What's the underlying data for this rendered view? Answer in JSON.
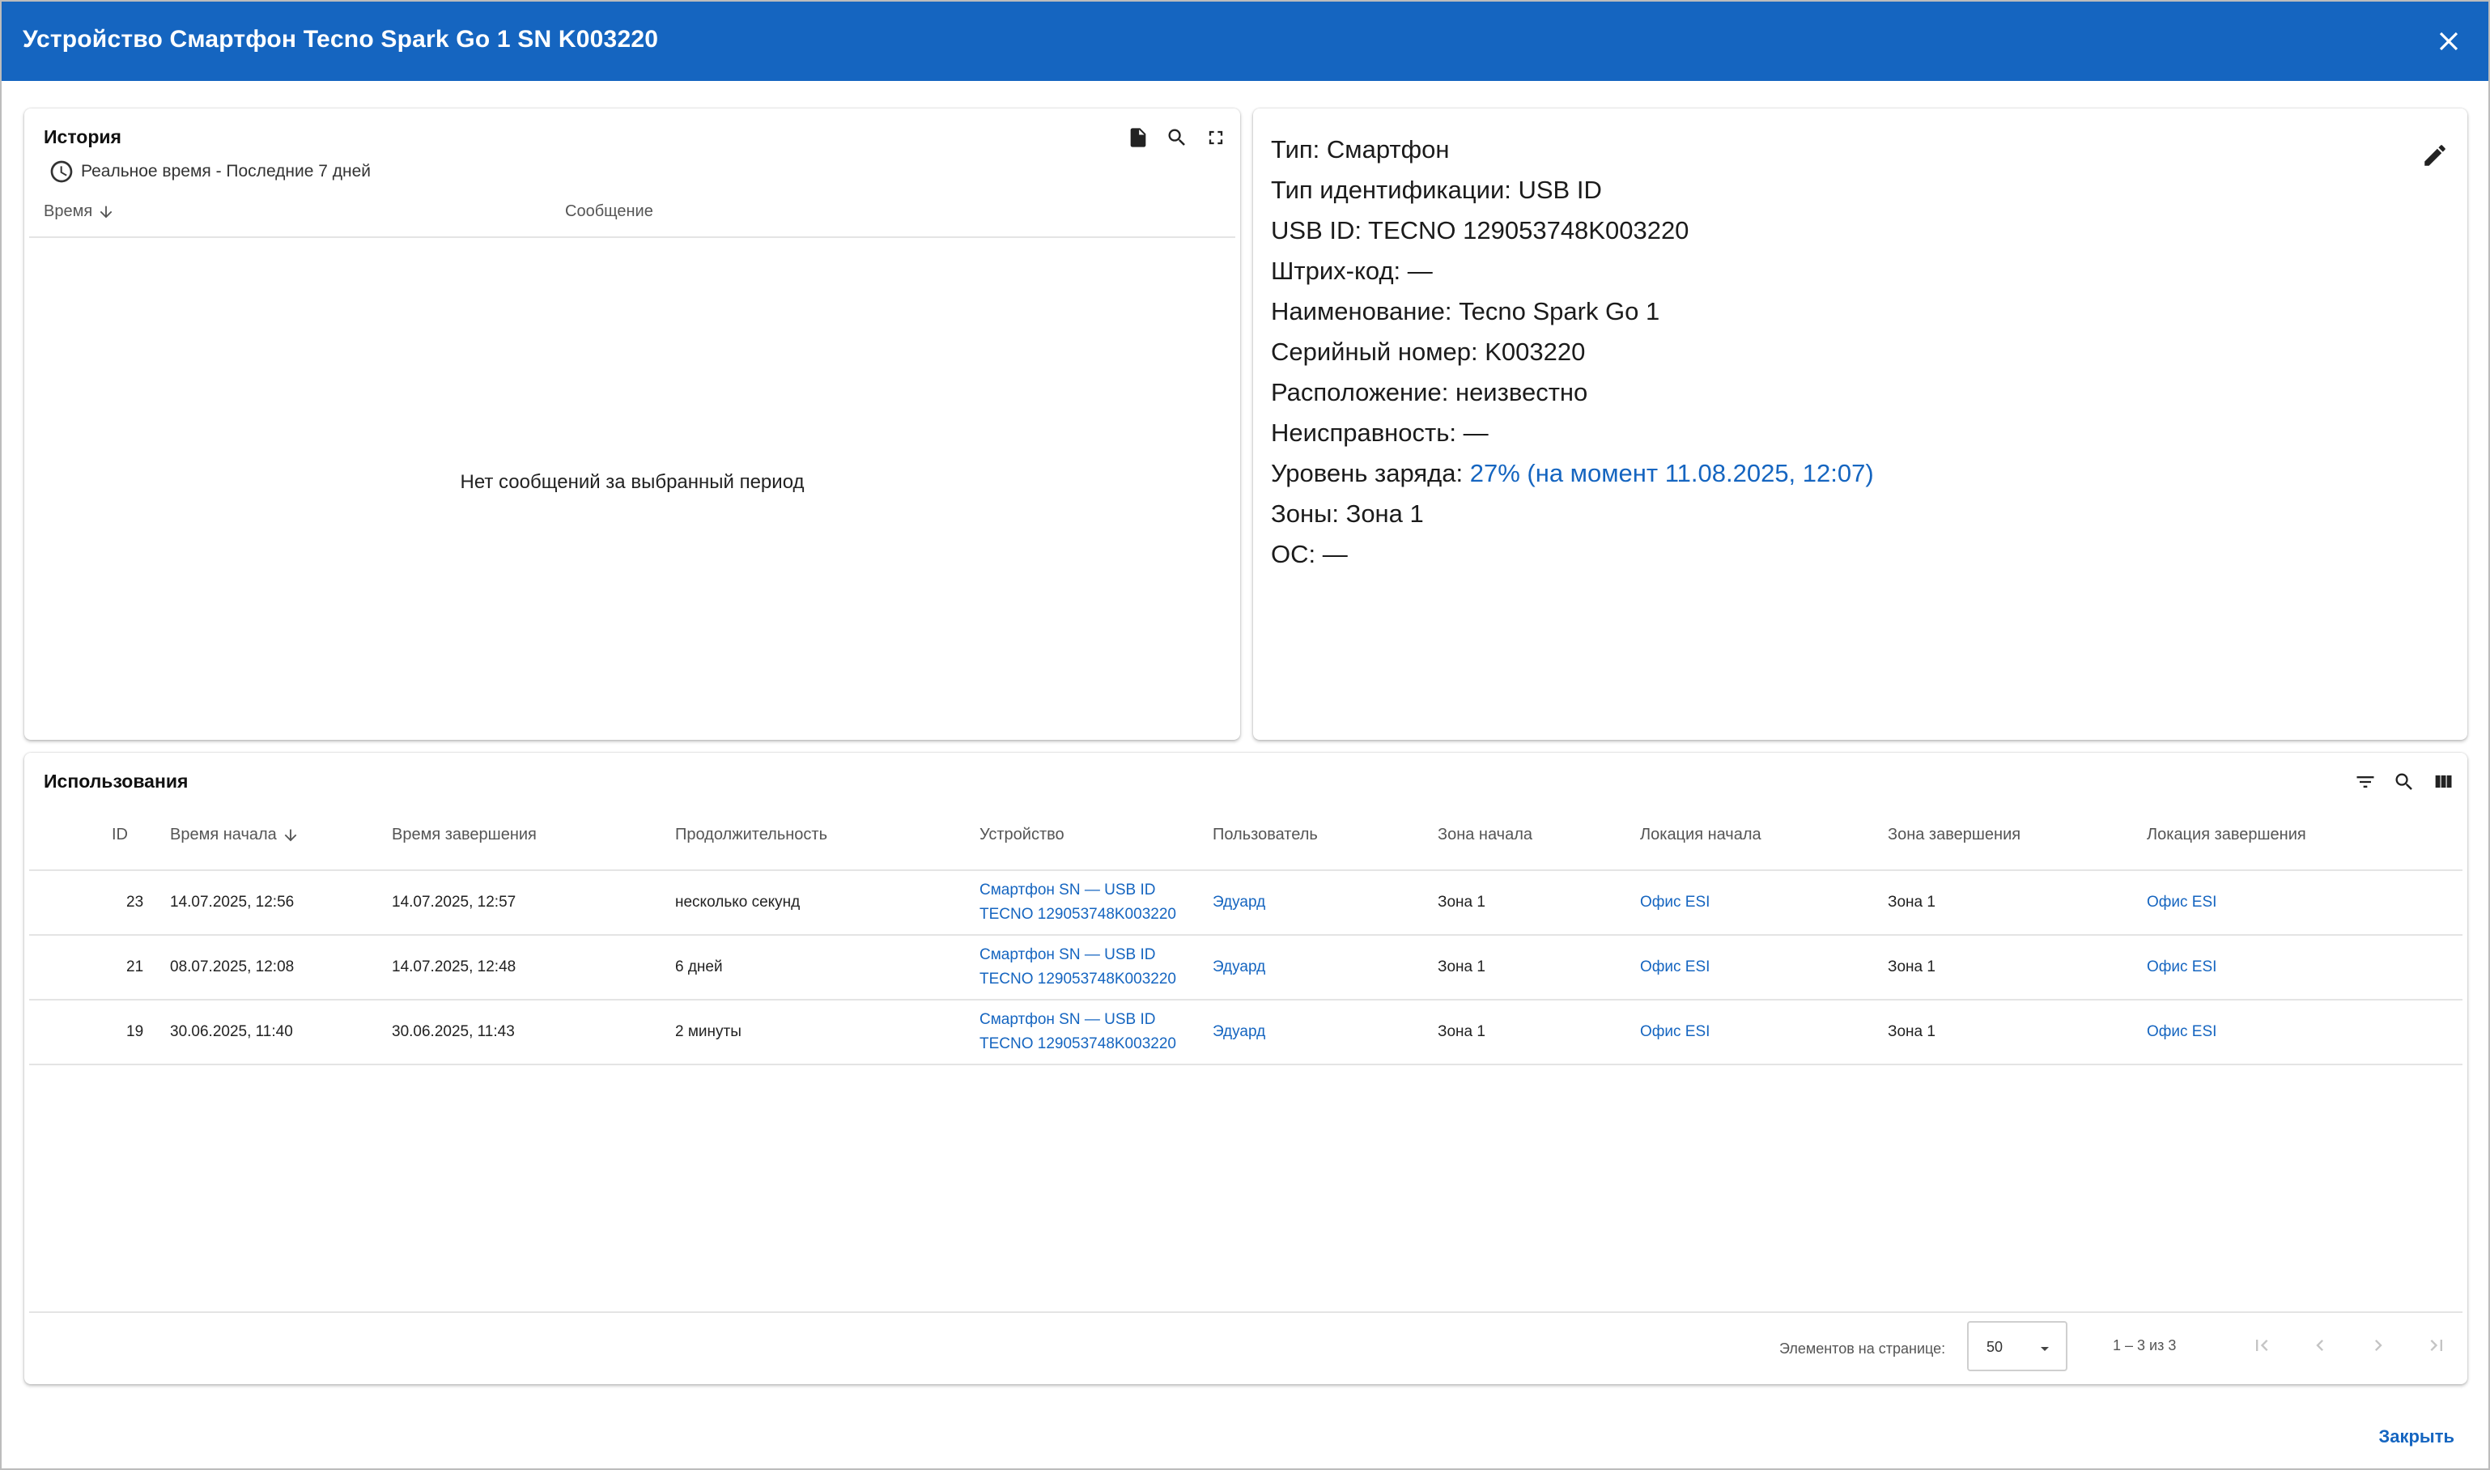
{
  "dialog": {
    "title": "Устройство Смартфон Tecno Spark Go 1 SN K003220",
    "close_label": "Закрыть"
  },
  "history": {
    "title": "История",
    "subtitle": "Реальное время - Последние 7 дней",
    "columns": [
      "Время",
      "Сообщение"
    ],
    "empty_message": "Нет сообщений за выбранный период"
  },
  "info": {
    "type": "Тип: Смартфон",
    "id_type": "Тип идентификации: USB ID",
    "usb_id": "USB ID: TECNO 129053748K003220",
    "barcode": "Штрих-код: —",
    "name": "Наименование: Tecno Spark Go 1",
    "serial": "Серийный номер: K003220",
    "location": "Расположение: неизвестно",
    "fault": "Неисправность: —",
    "battery_label": "Уровень заряда: ",
    "battery_value": "27% (на момент 11.08.2025, 12:07)",
    "zones": "Зоны: Зона 1",
    "os": "ОС: —"
  },
  "usage": {
    "title": "Использования",
    "columns": [
      "ID",
      "Время начала",
      "Время завершения",
      "Продолжительность",
      "Устройство",
      "Пользователь",
      "Зона начала",
      "Локация начала",
      "Зона завершения",
      "Локация завершения"
    ],
    "rows": [
      {
        "id": "23",
        "start": "14.07.2025, 12:56",
        "end": "14.07.2025, 12:57",
        "duration": "несколько секунд",
        "device_l1": "Смартфон SN — USB ID",
        "device_l2": "TECNO 129053748K003220",
        "user": "Эдуард",
        "zone_start": "Зона 1",
        "loc_start": "Офис ESI",
        "zone_end": "Зона 1",
        "loc_end": "Офис ESI"
      },
      {
        "id": "21",
        "start": "08.07.2025, 12:08",
        "end": "14.07.2025, 12:48",
        "duration": "6 дней",
        "device_l1": "Смартфон SN — USB ID",
        "device_l2": "TECNO 129053748K003220",
        "user": "Эдуард",
        "zone_start": "Зона 1",
        "loc_start": "Офис ESI",
        "zone_end": "Зона 1",
        "loc_end": "Офис ESI"
      },
      {
        "id": "19",
        "start": "30.06.2025, 11:40",
        "end": "30.06.2025, 11:43",
        "duration": "2 минуты",
        "device_l1": "Смартфон SN — USB ID",
        "device_l2": "TECNO 129053748K003220",
        "user": "Эдуард",
        "zone_start": "Зона 1",
        "loc_start": "Офис ESI",
        "zone_end": "Зона 1",
        "loc_end": "Офис ESI"
      }
    ],
    "pager": {
      "per_page_label": "Элементов на странице:",
      "per_page_value": "50",
      "range": "1 – 3 из 3"
    }
  },
  "colors": {
    "primary": "#1565c0",
    "header_bg": "#1565c0"
  }
}
